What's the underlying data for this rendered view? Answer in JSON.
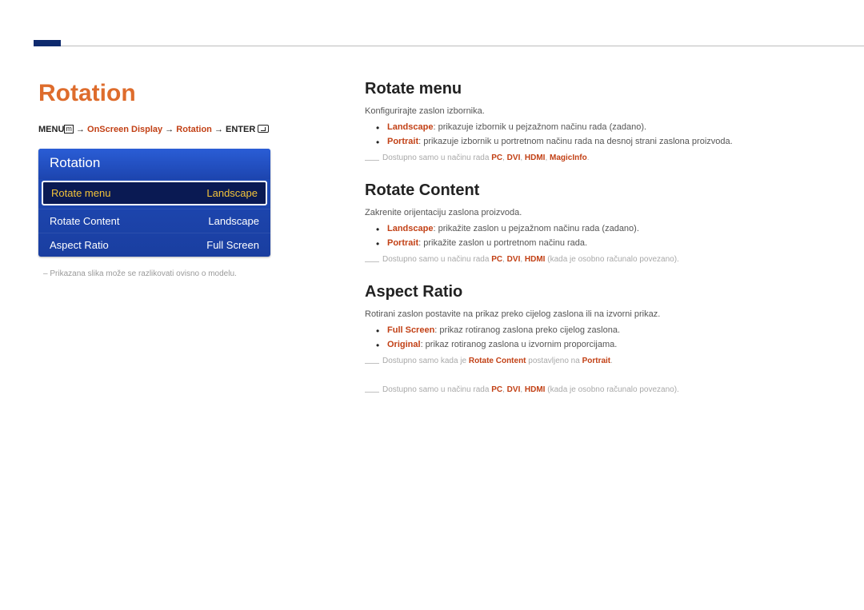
{
  "page_title": "Rotation",
  "breadcrumb": {
    "menu": "MENU",
    "arrow": " → ",
    "c1": "OnScreen Display",
    "c2": "Rotation",
    "enter": "ENTER"
  },
  "osd": {
    "title": "Rotation",
    "rows": [
      {
        "label": "Rotate menu",
        "value": "Landscape",
        "selected": true
      },
      {
        "label": "Rotate Content",
        "value": "Landscape",
        "selected": false
      },
      {
        "label": "Aspect Ratio",
        "value": "Full Screen",
        "selected": false
      }
    ]
  },
  "caption": "Prikazana slika može se razlikovati ovisno o modelu.",
  "sections": {
    "rotate_menu": {
      "title": "Rotate menu",
      "intro": "Konfigurirajte zaslon izbornika.",
      "opts": [
        {
          "key": "Landscape",
          "desc": ": prikazuje izbornik u pejzažnom načinu rada (zadano)."
        },
        {
          "key": "Portrait",
          "desc": ": prikazuje izbornik u portretnom načinu rada na desnoj strani zaslona proizvoda."
        }
      ],
      "note_pre": "Dostupno samo u načinu rada ",
      "note_modes": [
        "PC",
        "DVI",
        "HDMI",
        "MagicInfo"
      ],
      "note_post": "."
    },
    "rotate_content": {
      "title": "Rotate Content",
      "intro": "Zakrenite orijentaciju zaslona proizvoda.",
      "opts": [
        {
          "key": "Landscape",
          "desc": ": prikažite zaslon u pejzažnom načinu rada (zadano)."
        },
        {
          "key": "Portrait",
          "desc": ": prikažite zaslon u portretnom načinu rada."
        }
      ],
      "note_pre": "Dostupno samo u načinu rada ",
      "note_modes": [
        "PC",
        "DVI",
        "HDMI"
      ],
      "note_post": " (kada je osobno računalo povezano)."
    },
    "aspect_ratio": {
      "title": "Aspect Ratio",
      "intro": "Rotirani zaslon postavite na prikaz preko cijelog zaslona ili na izvorni prikaz.",
      "opts": [
        {
          "key": "Full Screen",
          "desc": ": prikaz rotiranog zaslona preko cijelog zaslona."
        },
        {
          "key": "Original",
          "desc": ": prikaz rotiranog zaslona u izvornim proporcijama."
        }
      ],
      "note1_pre": "Dostupno samo kada je ",
      "note1_opt": "Rotate Content",
      "note1_mid": " postavljeno na ",
      "note1_val": "Portrait",
      "note1_post": ".",
      "note2_pre": "Dostupno samo u načinu rada ",
      "note2_modes": [
        "PC",
        "DVI",
        "HDMI"
      ],
      "note2_post": " (kada je osobno računalo povezano)."
    }
  }
}
